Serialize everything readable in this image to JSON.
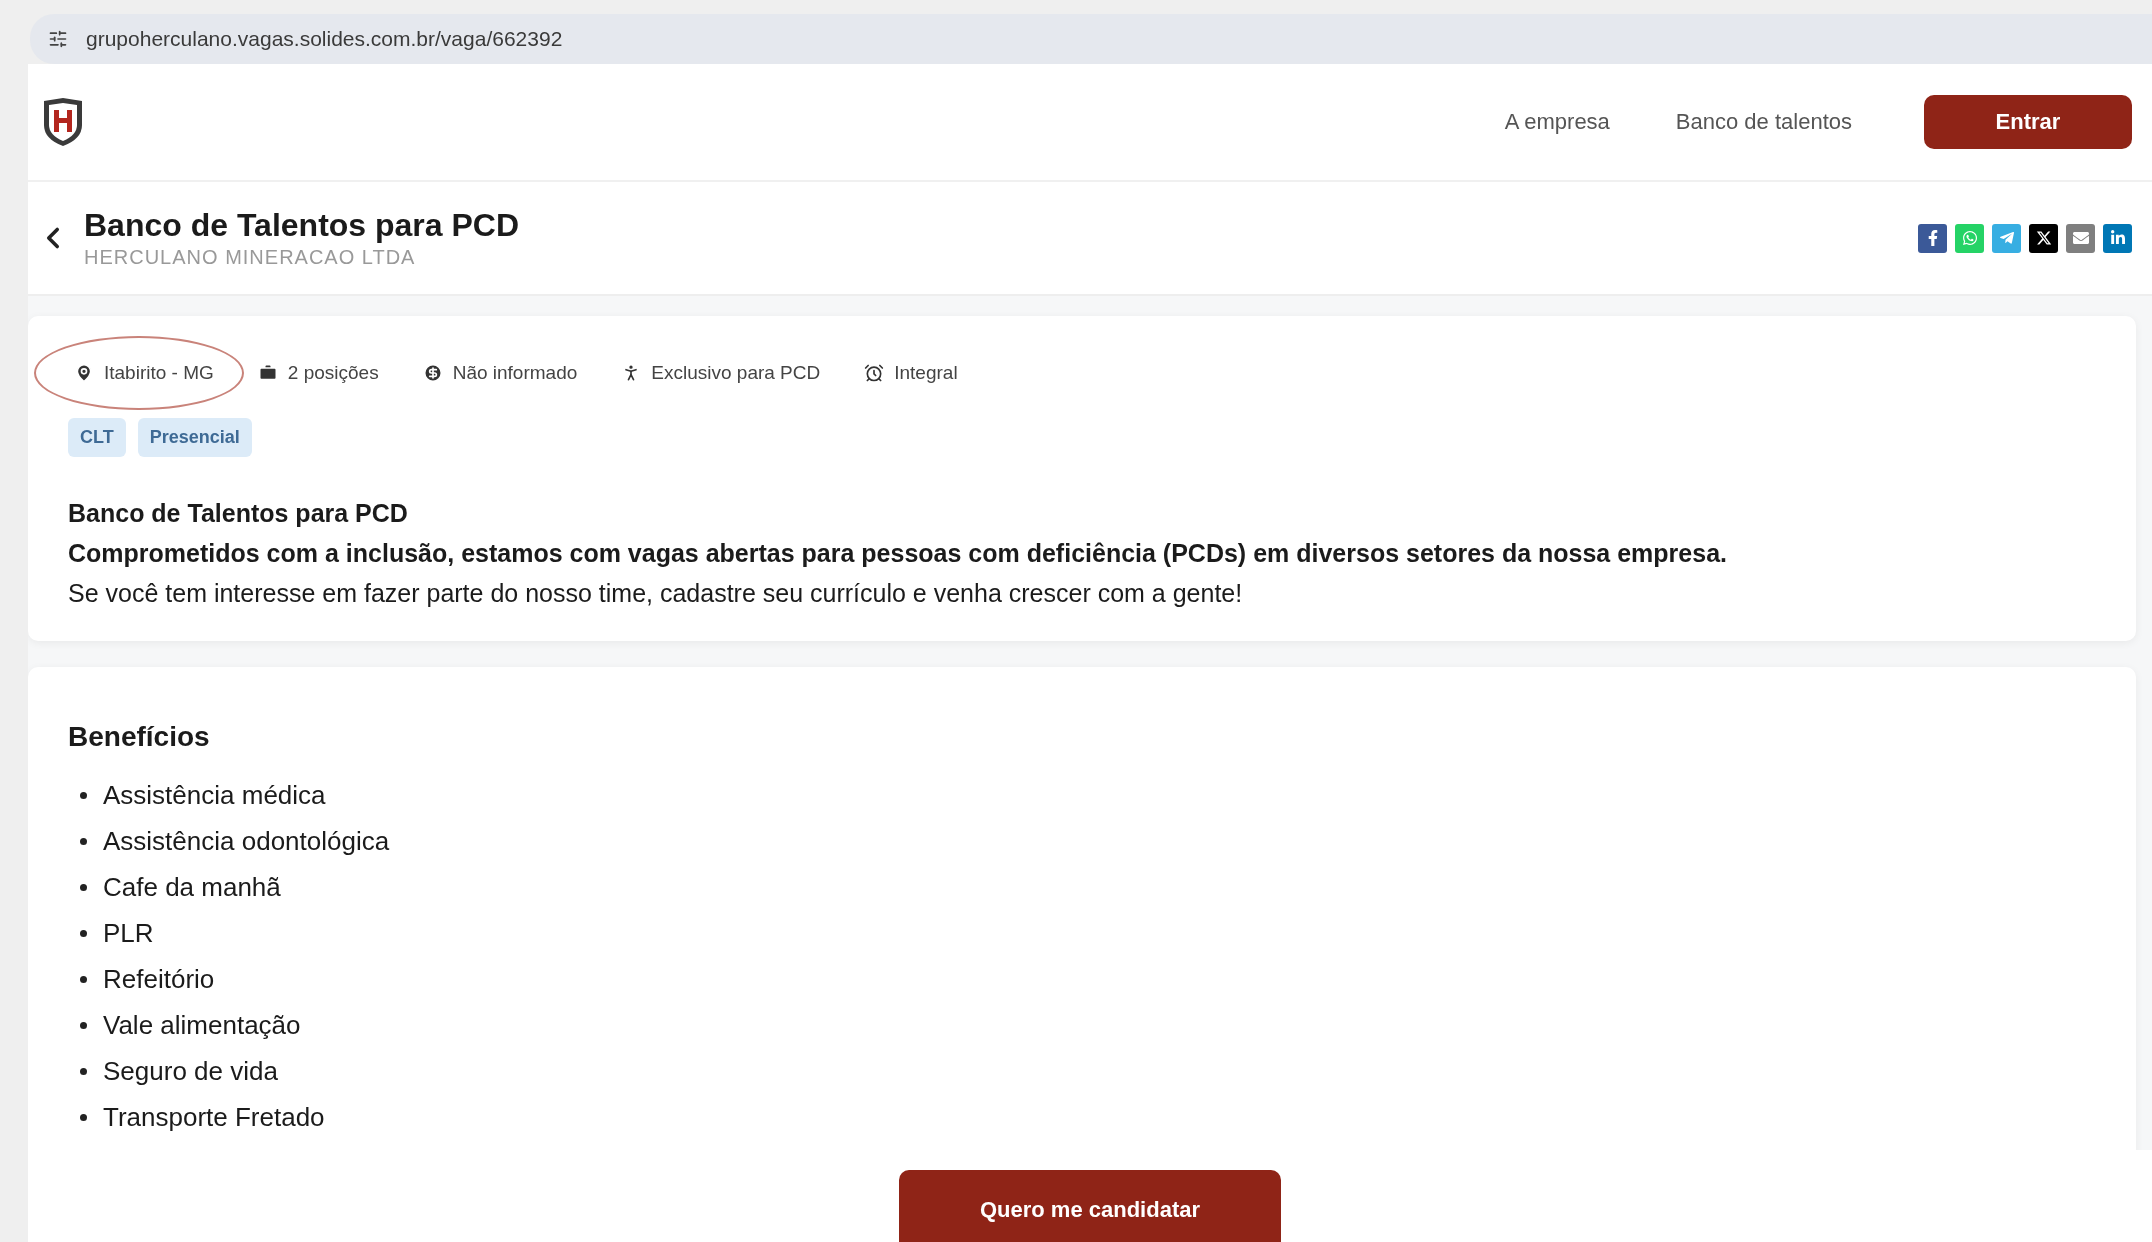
{
  "browser": {
    "url": "grupoherculano.vagas.solides.com.br/vaga/662392"
  },
  "header": {
    "nav": [
      "A empresa",
      "Banco de talentos"
    ],
    "login_button": "Entrar"
  },
  "job": {
    "title": "Banco de Talentos para PCD",
    "company": "HERCULANO MINERACAO LTDA"
  },
  "share_buttons": [
    {
      "kind": "facebook",
      "color": "#3b5998"
    },
    {
      "kind": "whatsapp",
      "color": "#25d366"
    },
    {
      "kind": "telegram",
      "color": "#37aee2"
    },
    {
      "kind": "x",
      "color": "#000000"
    },
    {
      "kind": "email",
      "color": "#7f7f7f"
    },
    {
      "kind": "linkedin",
      "color": "#0077b5"
    }
  ],
  "meta": [
    {
      "kind": "location",
      "label": "Itabirito - MG",
      "highlighted": true
    },
    {
      "kind": "positions",
      "label": "2 posições",
      "highlighted": false
    },
    {
      "kind": "salary",
      "label": "Não informado",
      "highlighted": false
    },
    {
      "kind": "accessibility",
      "label": "Exclusivo para PCD",
      "highlighted": false
    },
    {
      "kind": "schedule",
      "label": "Integral",
      "highlighted": false
    }
  ],
  "tags": [
    "CLT",
    "Presencial"
  ],
  "description": {
    "heading": "Banco de Talentos para PCD",
    "lead": "Comprometidos com a inclusão, estamos com vagas abertas para pessoas com deficiência (PCDs) em diversos setores da nossa empresa.",
    "body": "Se você tem interesse em fazer parte do nosso time, cadastre seu currículo e venha crescer com a gente!"
  },
  "benefits": {
    "title": "Benefícios",
    "items": [
      "Assistência médica",
      "Assistência odontológica",
      "Cafe da manhã",
      "PLR",
      "Refeitório",
      "Vale alimentação",
      "Seguro de vida",
      "Transporte Fretado"
    ]
  },
  "apply_button": "Quero me candidatar"
}
